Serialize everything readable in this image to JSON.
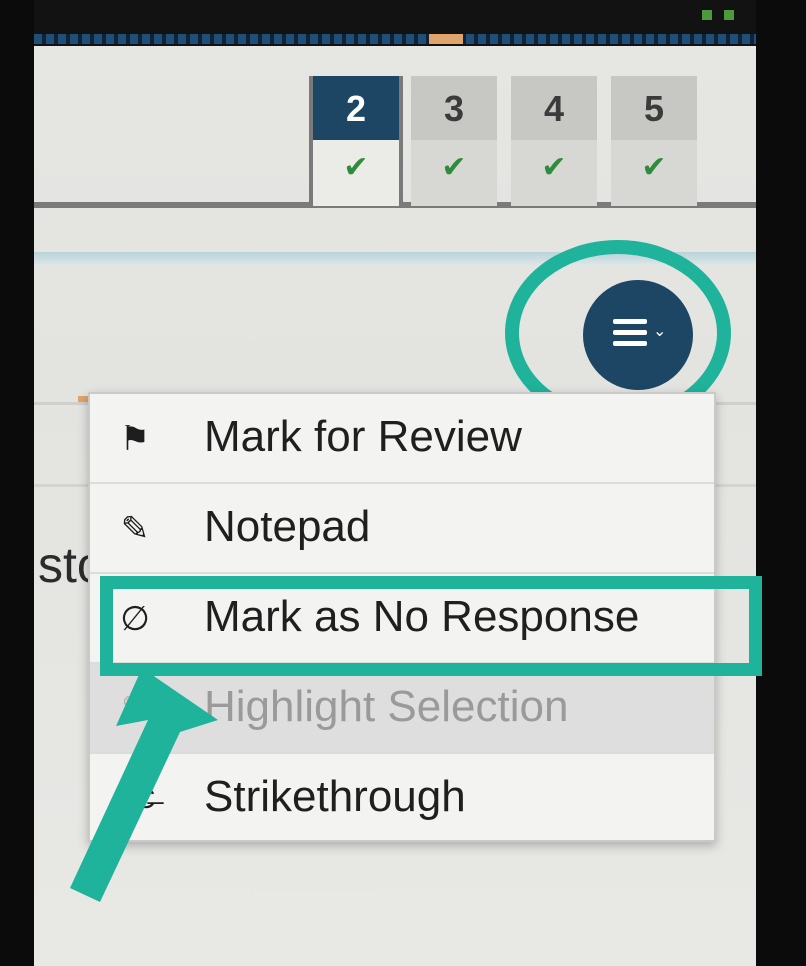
{
  "tabs": [
    {
      "number": "2",
      "status": "answered",
      "active": true
    },
    {
      "number": "3",
      "status": "answered",
      "active": false
    },
    {
      "number": "4",
      "status": "answered",
      "active": false
    },
    {
      "number": "5",
      "status": "answered",
      "active": false
    }
  ],
  "tab_check_glyph": "✔",
  "content": {
    "partial_text": "sto"
  },
  "menu_button": {
    "icon": "menu-hamburger-icon",
    "chevron": "⌄"
  },
  "menu": {
    "items": [
      {
        "label": "Mark for Review",
        "icon": "flag-icon",
        "glyph": "⚑",
        "disabled": false
      },
      {
        "label": "Notepad",
        "icon": "notepad-icon",
        "glyph": "✎",
        "disabled": false
      },
      {
        "label": "Mark as No Response",
        "icon": "no-response-icon",
        "glyph": "∅",
        "disabled": false
      },
      {
        "label": "Highlight Selection",
        "icon": "highlighter-icon",
        "glyph": "✎",
        "disabled": true
      },
      {
        "label": "Strikethrough",
        "icon": "strikethrough-icon",
        "glyph": "A̶C̶",
        "disabled": false
      }
    ]
  },
  "colors": {
    "accent_navy": "#1d4664",
    "annotation_teal": "#1fb39c",
    "check_green": "#2f8c3c"
  }
}
